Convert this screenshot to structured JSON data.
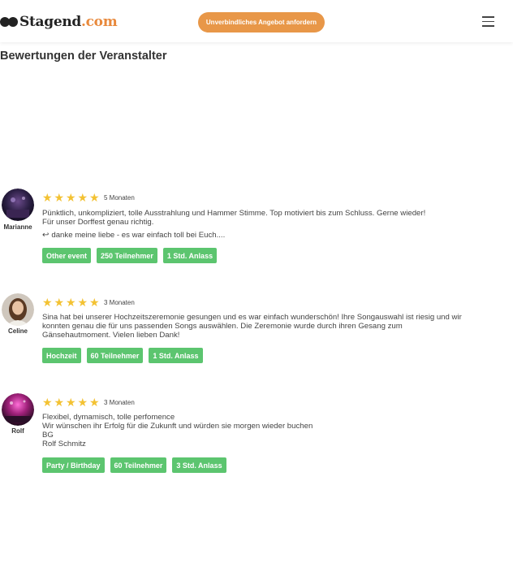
{
  "header": {
    "logo_text": "Stagend",
    "logo_tld": ".com",
    "cta_label": "Unverbindliches Angebot anfordern",
    "menu_icon": "hamburger-menu-icon"
  },
  "section": {
    "title": "Bewertungen der Veranstalter"
  },
  "colors": {
    "accent": "#e89748",
    "star": "#f3c233",
    "tag": "#5cc56f"
  },
  "reviews": [
    {
      "name": "Marianne",
      "stars": 5,
      "when": "5 Monaten",
      "lines": [
        "Pünktlich, unkompliziert, tolle Ausstrahlung und Hammer Stimme. Top motiviert bis zum Schluss. Gerne wieder!",
        "Für unser Dorffest genau richtig."
      ],
      "reply": "danke meine liebe - es war einfach toll bei Euch....",
      "tags": [
        "Other event",
        "250 Teilnehmer",
        "1 Std. Anlass"
      ]
    },
    {
      "name": "Celine",
      "stars": 5,
      "when": "3 Monaten",
      "lines": [
        "Sina hat bei unserer Hochzeitszeremonie gesungen und es war einfach wunderschön! Ihre Songauswahl ist riesig und wir",
        "konnten genau die für uns passenden Songs auswählen. Die Zeremonie wurde durch ihren Gesang zum",
        "Gänsehautmoment. Vielen lieben Dank!"
      ],
      "tags": [
        "Hochzeit",
        "60 Teilnehmer",
        "1 Std. Anlass"
      ]
    },
    {
      "name": "Rolf",
      "stars": 5,
      "when": "3 Monaten",
      "lines": [
        "Flexibel, dymamisch, tolle perfomence",
        "Wir wünschen ihr Erfolg für die Zukunft und würden sie morgen wieder buchen",
        "BG",
        "Rolf Schmitz"
      ],
      "tags": [
        "Party / Birthday",
        "60 Teilnehmer",
        "3 Std. Anlass"
      ]
    }
  ]
}
